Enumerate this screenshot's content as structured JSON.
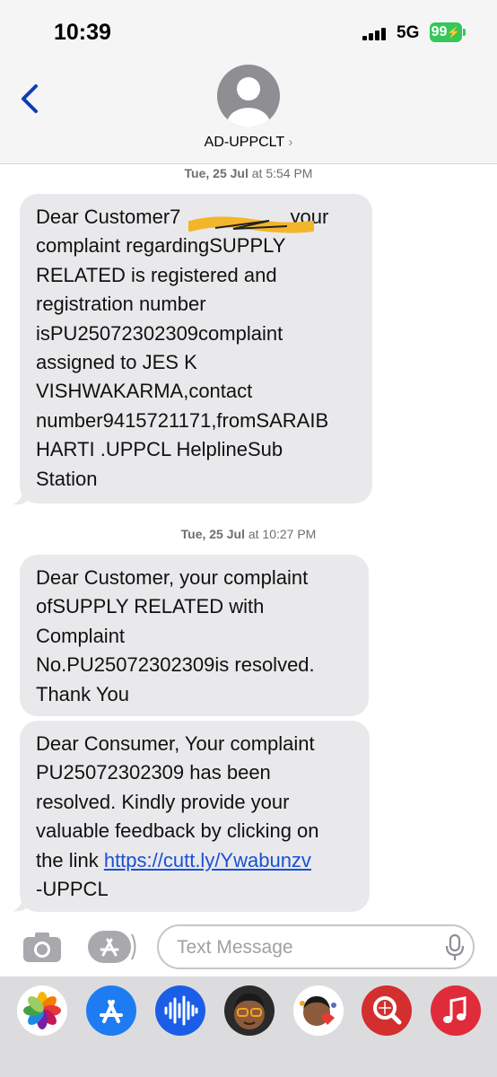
{
  "status_bar": {
    "time": "10:39",
    "network": "5G",
    "battery": "99"
  },
  "header": {
    "contact_name": "AD-UPPCLT",
    "chevron": "›"
  },
  "conversation": [
    {
      "timestamp_day": "Tue, 25 Jul",
      "timestamp_time": " at 5:54 PM",
      "messages": [
        {
          "lines": [
            "Dear Customer7",
            "your",
            "complaint regardingSUPPLY",
            "RELATED is registered and",
            "registration number",
            "isPU25072302309complaint",
            "assigned to JES K",
            "VISHWAKARMA,contact",
            "number9415721171,fromSARAIB",
            "HARTI .UPPCL HelplineSub",
            "Station"
          ]
        }
      ]
    },
    {
      "timestamp_day": "Tue, 25 Jul",
      "timestamp_time": " at 10:27 PM",
      "messages": [
        {
          "lines": [
            "Dear Customer, your complaint",
            "ofSUPPLY RELATED with",
            "Complaint",
            "No.PU25072302309is resolved.",
            "Thank You"
          ]
        },
        {
          "lines": [
            "Dear Consumer, Your complaint",
            "PU25072302309 has been",
            "resolved. Kindly provide your",
            "valuable feedback by clicking on",
            "the link ",
            "https://cutt.ly/Ywabunzv",
            "-UPPCL"
          ]
        }
      ]
    }
  ],
  "input_bar": {
    "placeholder": "Text Message"
  },
  "app_drawer": [
    {
      "icon": "photos-icon"
    },
    {
      "icon": "app-store-icon"
    },
    {
      "icon": "audio-message-icon"
    },
    {
      "icon": "memoji-icon"
    },
    {
      "icon": "memoji-stickers-icon"
    },
    {
      "icon": "web-search-icon"
    },
    {
      "icon": "music-icon"
    }
  ],
  "colors": {
    "bubble_bg": "#e9e9eb",
    "link": "#1a4fd6",
    "accent": "#0a3fb6",
    "battery": "#34c759"
  }
}
